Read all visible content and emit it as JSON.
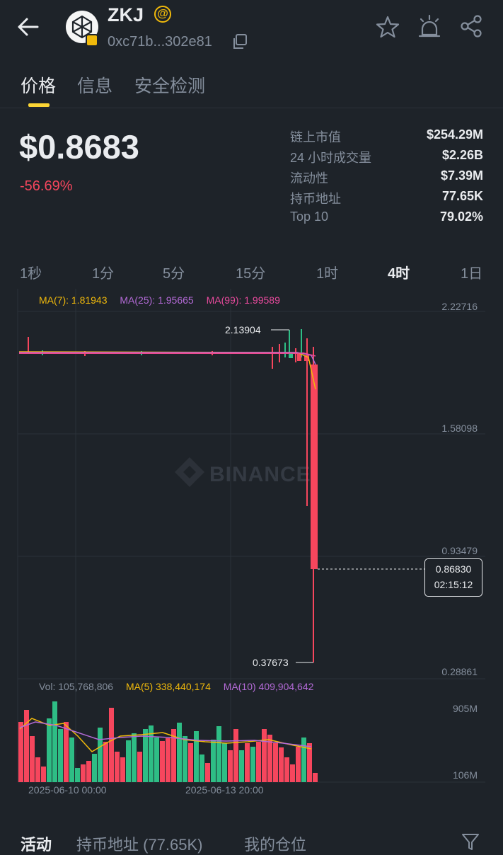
{
  "header": {
    "symbol": "ZKJ",
    "badge": "@",
    "contract": "0xc71b...302e81"
  },
  "tabs": [
    "价格",
    "信息",
    "安全检测"
  ],
  "price": {
    "value": "$0.8683",
    "change": "-56.69%"
  },
  "stats": [
    {
      "label": "链上市值",
      "value": "$254.29M"
    },
    {
      "label": "24 小时成交量",
      "value": "$2.26B"
    },
    {
      "label": "流动性",
      "value": "$7.39M"
    },
    {
      "label": "持币地址",
      "value": "77.65K"
    },
    {
      "label": "Top 10",
      "value": "79.02%"
    }
  ],
  "intervals": [
    "1秒",
    "1分",
    "5分",
    "15分",
    "1时",
    "4时",
    "1日"
  ],
  "active_interval": "4时",
  "ma": {
    "ma7": "MA(7): 1.81943",
    "ma25": "MA(25): 1.95665",
    "ma99": "MA(99): 1.99589"
  },
  "axis": {
    "top": "2.22716",
    "mid1": "1.58098",
    "mid2": "0.93479",
    "bottom": "0.28861"
  },
  "annotations": {
    "high": "2.13904",
    "low": "0.37673",
    "last_price": "0.86830",
    "countdown": "02:15:12"
  },
  "watermark": "BINANCE",
  "volume": {
    "vol": "Vol: 105,768,806",
    "ma5": "MA(5) 338,440,174",
    "ma10": "MA(10) 409,904,642",
    "axis_top": "905M",
    "axis_bottom": "106M"
  },
  "time_labels": [
    "2025-06-10 00:00",
    "2025-06-13 20:00"
  ],
  "bottom_tabs": [
    "活动",
    "持币地址 (77.65K)",
    "我的仓位"
  ],
  "colors": {
    "bg": "#1e2329",
    "up": "#2ebd85",
    "down": "#f6465d",
    "accent": "#fcd535",
    "ma7": "#f0b90b",
    "ma25": "#b36ad6",
    "ma99": "#e84a9d"
  },
  "chart_data": {
    "type": "candlestick",
    "ylim": [
      0.28861,
      2.22716
    ],
    "high_marker": 2.13904,
    "low_marker": 0.37673,
    "last": 0.8683,
    "volume_ylim": [
      106,
      905
    ],
    "volume_unit": "M"
  }
}
